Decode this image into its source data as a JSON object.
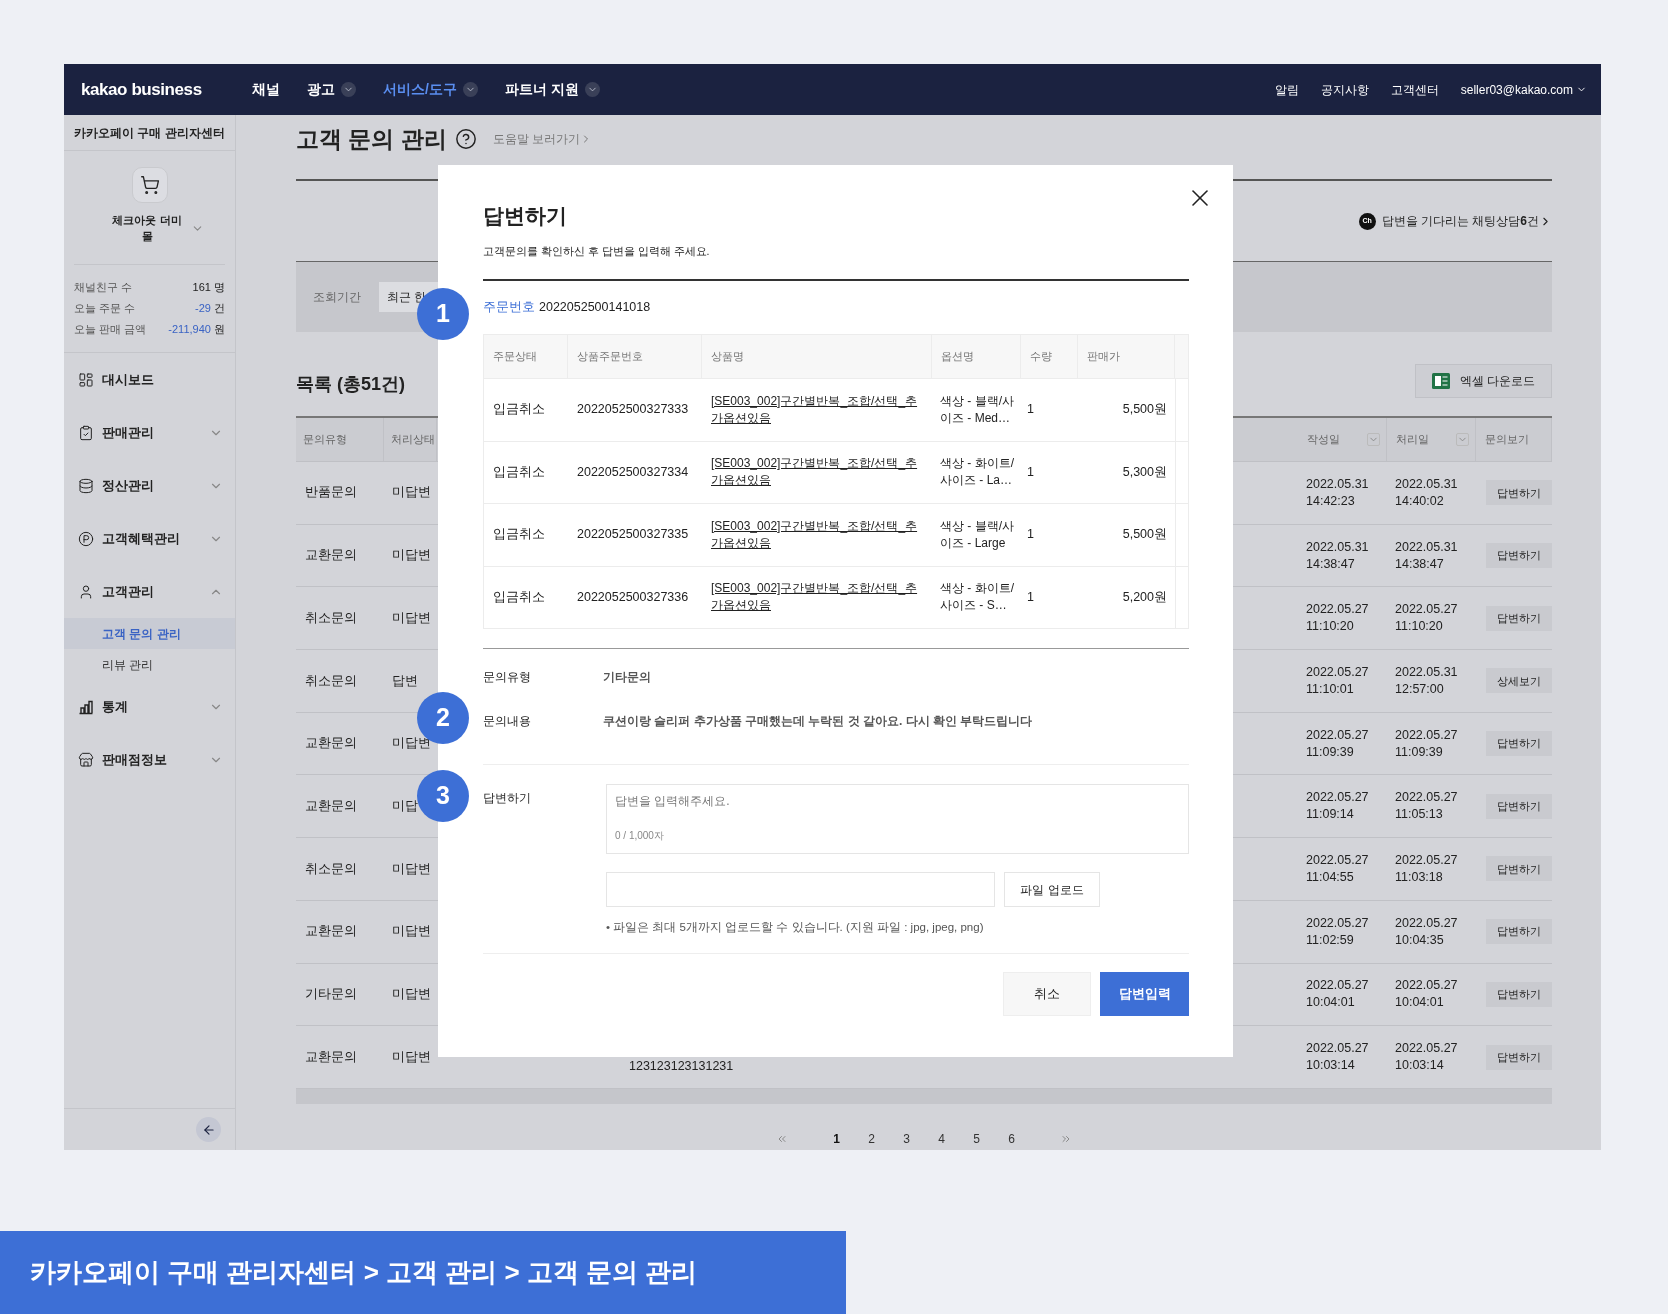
{
  "nav": {
    "logo": "kakao business",
    "menus": [
      {
        "label": "채널",
        "selected": false,
        "dropdown": false
      },
      {
        "label": "광고",
        "selected": false,
        "dropdown": true
      },
      {
        "label": "서비스/도구",
        "selected": true,
        "dropdown": true
      },
      {
        "label": "파트너 지원",
        "selected": false,
        "dropdown": true
      }
    ],
    "links": [
      "알림",
      "공지사항",
      "고객센터"
    ],
    "account": "seller03@kakao.com"
  },
  "sidebar": {
    "title": "카카오페이 구매 관리자센터",
    "shop": "체크아웃 더미 몰",
    "stats": [
      {
        "label": "채널친구 수",
        "value": "161",
        "unit": "명",
        "negative": false
      },
      {
        "label": "오늘 주문 수",
        "value": "-29",
        "unit": "건",
        "negative": true
      },
      {
        "label": "오늘 판매 금액",
        "value": "-211,940",
        "unit": "원",
        "negative": true
      }
    ],
    "menu": [
      {
        "label": "대시보드"
      },
      {
        "label": "판매관리",
        "expanded": false
      },
      {
        "label": "정산관리",
        "expanded": false
      },
      {
        "label": "고객혜택관리",
        "expanded": false
      },
      {
        "label": "고객관리",
        "expanded": true,
        "children": [
          {
            "label": "고객 문의 관리",
            "selected": true
          },
          {
            "label": "리뷰 관리",
            "selected": false
          }
        ]
      },
      {
        "label": "통계",
        "expanded": false
      },
      {
        "label": "판매점정보",
        "expanded": false
      }
    ]
  },
  "page": {
    "title": "고객 문의 관리",
    "help_link": "도움말 보러가기",
    "chat_badge": "Ch",
    "chat_notice": "답변을 기다리는 채팅상담**6**건",
    "filter": {
      "label": "조회기간",
      "value": "최근 한"
    },
    "list_title": "목록 (총51건)",
    "excel_button": "엑셀 다운로드",
    "table": {
      "columns": [
        {
          "label": "문의유형",
          "sortable": false
        },
        {
          "label": "처리상태",
          "sortable": false
        },
        {
          "label": "작성일",
          "sortable": true
        },
        {
          "label": "처리일",
          "sortable": true
        },
        {
          "label": "문의보기",
          "sortable": false
        }
      ],
      "rows": [
        {
          "type": "반품문의",
          "status": "미답변",
          "created_date": "2022.05.31",
          "created_time": "14:42:23",
          "processed_date": "2022.05.31",
          "processed_time": "14:40:02",
          "action": "답변하기"
        },
        {
          "type": "교환문의",
          "status": "미답변",
          "created_date": "2022.05.31",
          "created_time": "14:38:47",
          "processed_date": "2022.05.31",
          "processed_time": "14:38:47",
          "action": "답변하기"
        },
        {
          "type": "취소문의",
          "status": "미답변",
          "created_date": "2022.05.27",
          "created_time": "11:10:20",
          "processed_date": "2022.05.27",
          "processed_time": "11:10:20",
          "action": "답변하기"
        },
        {
          "type": "취소문의",
          "status": "답변",
          "created_date": "2022.05.27",
          "created_time": "11:10:01",
          "processed_date": "2022.05.31",
          "processed_time": "12:57:00",
          "action": "상세보기"
        },
        {
          "type": "교환문의",
          "status": "미답변",
          "created_date": "2022.05.27",
          "created_time": "11:09:39",
          "processed_date": "2022.05.27",
          "processed_time": "11:09:39",
          "action": "답변하기"
        },
        {
          "type": "교환문의",
          "status": "미답",
          "created_date": "2022.05.27",
          "created_time": "11:09:14",
          "processed_date": "2022.05.27",
          "processed_time": "11:05:13",
          "action": "답변하기"
        },
        {
          "type": "취소문의",
          "status": "미답변",
          "created_date": "2022.05.27",
          "created_time": "11:04:55",
          "processed_date": "2022.05.27",
          "processed_time": "11:03:18",
          "action": "답변하기"
        },
        {
          "type": "교환문의",
          "status": "미답변",
          "created_date": "2022.05.27",
          "created_time": "11:02:59",
          "processed_date": "2022.05.27",
          "processed_time": "10:04:35",
          "action": "답변하기"
        },
        {
          "type": "기타문의",
          "status": "미답변",
          "created_date": "2022.05.27",
          "created_time": "10:04:01",
          "processed_date": "2022.05.27",
          "processed_time": "10:04:01",
          "action": "답변하기"
        },
        {
          "type": "교환문의",
          "status": "미답변",
          "column_3": "123123123131231",
          "created_date": "2022.05.27",
          "created_time": "10:03:14",
          "processed_date": "2022.05.27",
          "processed_time": "10:03:14",
          "action": "답변하기"
        }
      ]
    },
    "pagination": [
      {
        "label": "1",
        "selected": true
      },
      {
        "label": "2",
        "selected": false
      },
      {
        "label": "3",
        "selected": false
      },
      {
        "label": "4",
        "selected": false
      },
      {
        "label": "5",
        "selected": false
      },
      {
        "label": "6",
        "selected": false
      }
    ]
  },
  "modal": {
    "title": "답변하기",
    "subtitle": "고객문의를 확인하신 후 답변을 입력해 주세요.",
    "order_label": "주문번호",
    "order_number": "2022052500141018",
    "items_table": {
      "columns": [
        "주문상태",
        "상품주문번호",
        "상품명",
        "옵션명",
        "수량",
        "판매가"
      ],
      "rows": [
        {
          "status": "입금취소",
          "item_order_number": "2022052500327333",
          "product": "[SE003_002]구간별반복_조합/선택_추가옵션있음",
          "option": "색상 - 블랙/사이즈 - Med…",
          "quantity": "1",
          "price": "5,500원"
        },
        {
          "status": "입금취소",
          "item_order_number": "2022052500327334",
          "product": "[SE003_002]구간별반복_조합/선택_추가옵션있음",
          "option": "색상 - 화이트/사이즈 - La…",
          "quantity": "1",
          "price": "5,300원"
        },
        {
          "status": "입금취소",
          "item_order_number": "2022052500327335",
          "product": "[SE003_002]구간별반복_조합/선택_추가옵션있음",
          "option": "색상 - 블랙/사이즈 - Large",
          "quantity": "1",
          "price": "5,500원"
        },
        {
          "status": "입금취소",
          "item_order_number": "2022052500327336",
          "product": "[SE003_002]구간별반복_조합/선택_추가옵션있음",
          "option": "색상 - 화이트/사이즈 - S…",
          "quantity": "1",
          "price": "5,200원"
        }
      ]
    },
    "inquiry_type_label": "문의유형",
    "inquiry_type": "기타문의",
    "content_label": "문의내용",
    "content": "쿠션이랑 슬리퍼 추가상품 구매했는데 누락된 것 같아요. 다시 확인 부탁드립니다",
    "answer_label": "답변하기",
    "answer_placeholder": "답변을 입력해주세요.",
    "char_count": "0 / 1,000자",
    "upload_button": "파일 업로드",
    "upload_note": "• 파일은 최대 5개까지 업로드할 수 있습니다. (지원 파일 : jpg, jpeg, png)",
    "buttons": [
      {
        "label": "취소",
        "primary": false
      },
      {
        "label": "답변입력",
        "primary": true
      }
    ]
  },
  "badges": [
    "1",
    "2",
    "3"
  ],
  "caption": "카카오페이 구매 관리자센터 > 고객 관리 > 고객 문의 관리"
}
